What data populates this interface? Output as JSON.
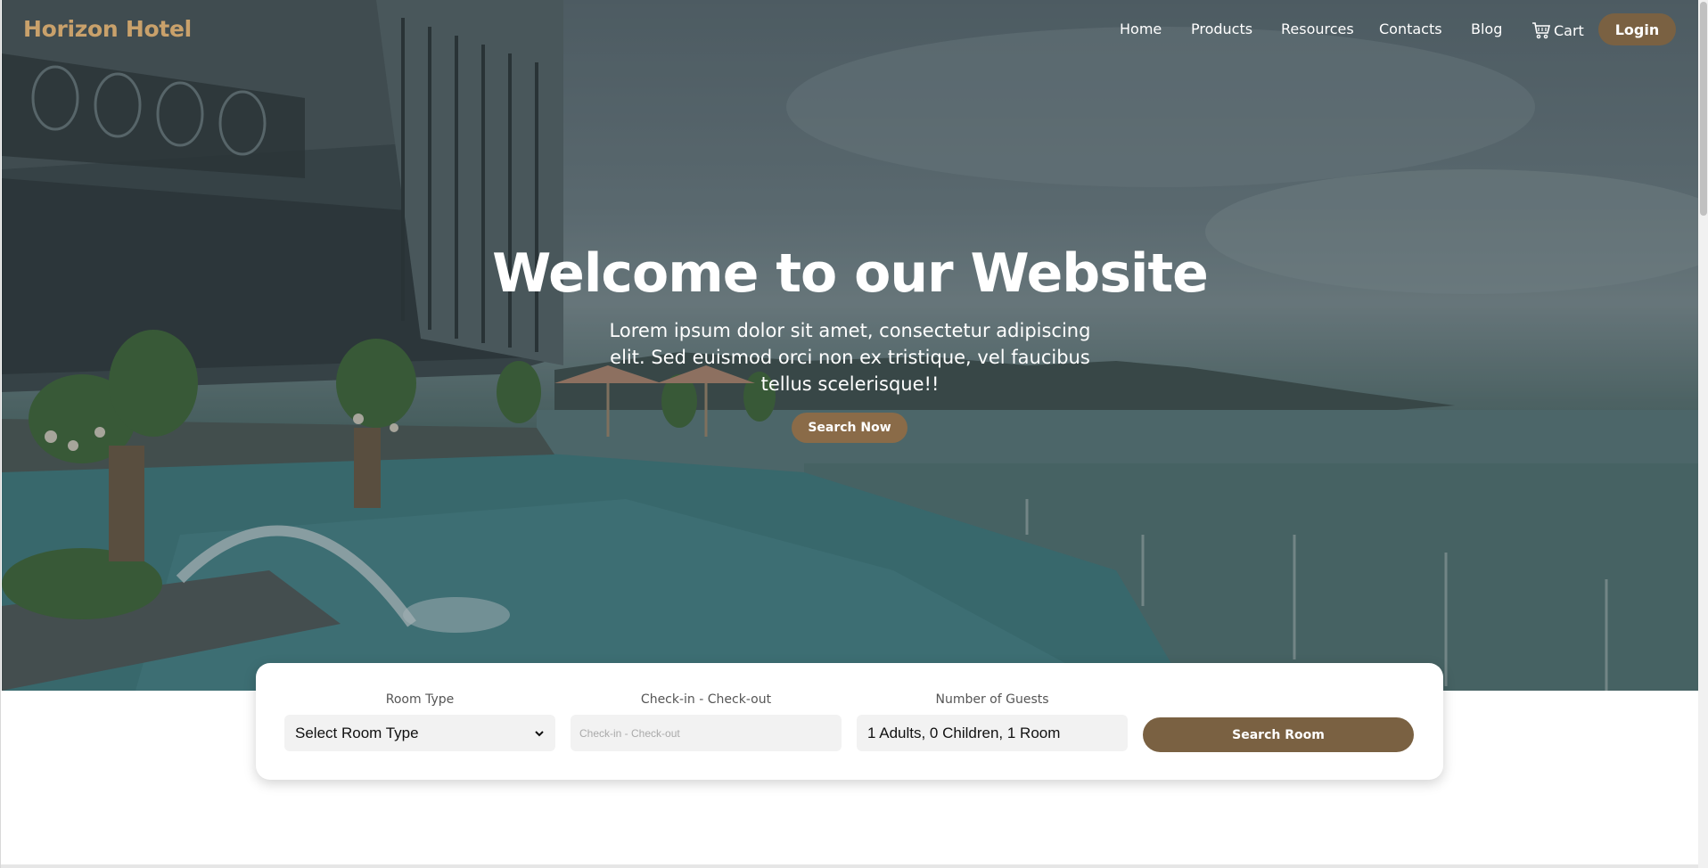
{
  "brand": "Horizon Hotel",
  "nav": {
    "links": [
      "Home",
      "Products",
      "Resources",
      "Contacts",
      "Blog"
    ],
    "cart_label": "Cart",
    "login_label": "Login"
  },
  "hero": {
    "title": "Welcome to our Website",
    "subtitle": "Lorem ipsum dolor sit amet, consectetur adipiscing elit. Sed euismod orci non ex tristique, vel faucibus tellus scelerisque!!",
    "cta_label": "Search Now"
  },
  "booking": {
    "room_type_label": "Room Type",
    "room_type_value": "Select Room Type",
    "dates_label": "Check-in - Check-out",
    "dates_placeholder": "Check-in - Check-out",
    "guests_label": "Number of Guests",
    "guests_value": "1 Adults, 0 Children, 1 Room",
    "submit_label": "Search Room"
  },
  "colors": {
    "brand": "#c9a16b",
    "accent": "#7a6142"
  }
}
